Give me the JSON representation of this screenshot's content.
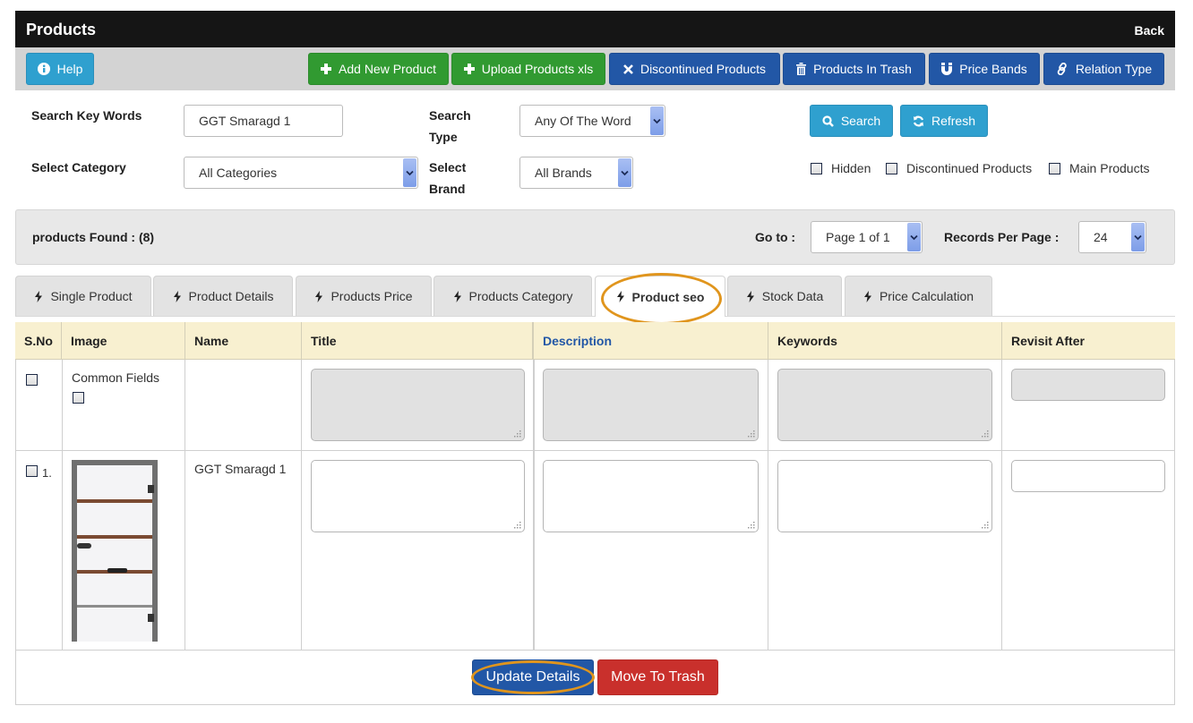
{
  "header": {
    "title": "Products",
    "back_label": "Back"
  },
  "toolbar": {
    "help_label": "Help",
    "buttons": [
      {
        "label": "Add New Product",
        "icon": "plus-icon",
        "color": "#319a31"
      },
      {
        "label": "Upload Products xls",
        "icon": "plus-icon",
        "color": "#319a31"
      },
      {
        "label": "Discontinued Products",
        "icon": "times-icon",
        "color": "#2257a6"
      },
      {
        "label": "Products In Trash",
        "icon": "trash-icon",
        "color": "#2257a6"
      },
      {
        "label": "Price Bands",
        "icon": "magnet-icon",
        "color": "#2257a6"
      },
      {
        "label": "Relation Type",
        "icon": "link-icon",
        "color": "#2257a6"
      }
    ]
  },
  "search": {
    "keywords_label": "Search Key Words",
    "keywords_value": "GGT Smaragd 1",
    "type_label_line1": "Search",
    "type_label_line2": "Type",
    "type_value": "Any Of The Word",
    "category_label": "Select Category",
    "category_value": "All Categories",
    "brand_label_line1": "Select",
    "brand_label_line2": "Brand",
    "brand_value": "All Brands",
    "search_button": "Search",
    "refresh_button": "Refresh",
    "filters": [
      {
        "label": "Hidden",
        "checked": false
      },
      {
        "label": "Discontinued Products",
        "checked": false
      },
      {
        "label": "Main Products",
        "checked": false
      }
    ]
  },
  "results": {
    "found_text": "products Found : (8)",
    "goto_label": "Go to :",
    "page_value": "Page 1 of 1",
    "records_label": "Records Per Page :",
    "records_value": "24"
  },
  "tabs": [
    {
      "label": "Single Product",
      "active": false
    },
    {
      "label": "Product Details",
      "active": false
    },
    {
      "label": "Products Price",
      "active": false
    },
    {
      "label": "Products Category",
      "active": false
    },
    {
      "label": "Product seo",
      "active": true
    },
    {
      "label": "Stock Data",
      "active": false
    },
    {
      "label": "Price Calculation",
      "active": false
    }
  ],
  "table": {
    "columns": [
      "S.No",
      "Image",
      "Name",
      "Title",
      "Description",
      "Keywords",
      "Revisit After"
    ],
    "highlight_column_color": "#2257a6",
    "common_row": {
      "label": "Common Fields"
    },
    "rows": [
      {
        "sno": "1.",
        "name": "GGT Smaragd 1",
        "title": "",
        "description": "",
        "keywords": "",
        "revisit_after": ""
      }
    ]
  },
  "actions": {
    "update_label": "Update Details",
    "trash_label": "Move To Trash"
  },
  "colors": {
    "highlight_ring": "#e0951d",
    "header_bg": "#151515",
    "table_header_bg": "#f8f0d0"
  }
}
